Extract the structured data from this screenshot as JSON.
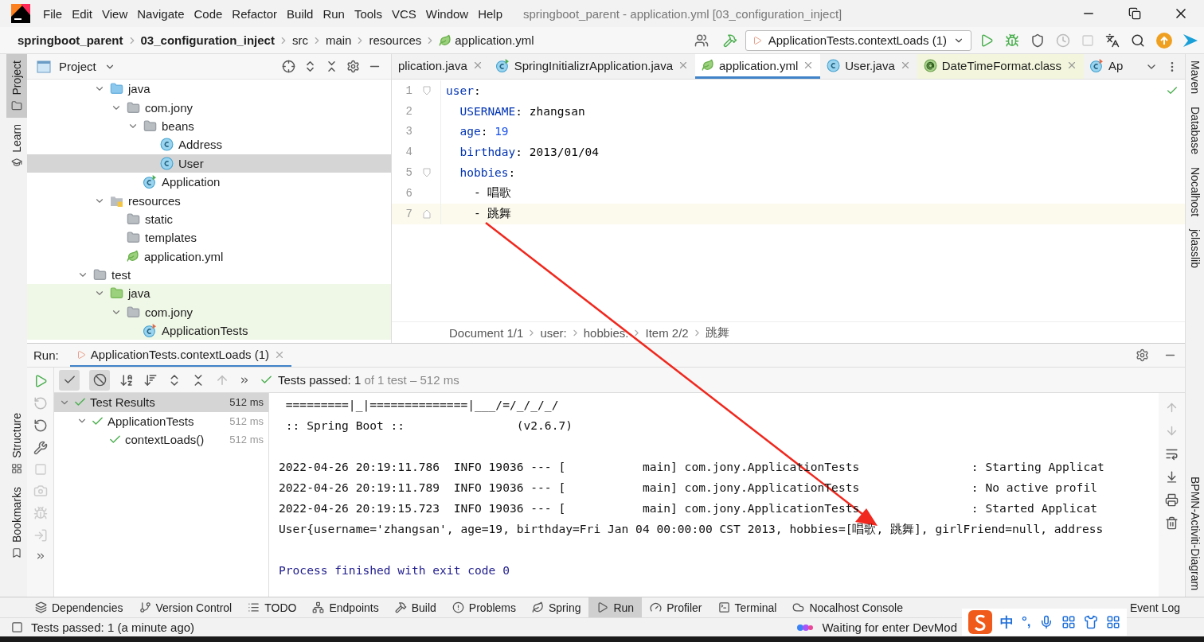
{
  "window": {
    "title": "springboot_parent - application.yml [03_configuration_inject]"
  },
  "menu": [
    "File",
    "Edit",
    "View",
    "Navigate",
    "Code",
    "Refactor",
    "Build",
    "Run",
    "Tools",
    "VCS",
    "Window",
    "Help"
  ],
  "breadcrumbs": [
    {
      "label": "springboot_parent",
      "bold": true,
      "kind": "folder"
    },
    {
      "label": "03_configuration_inject",
      "bold": true,
      "kind": "folder"
    },
    {
      "label": "src",
      "bold": false,
      "kind": "folder"
    },
    {
      "label": "main",
      "bold": false,
      "kind": "folder"
    },
    {
      "label": "resources",
      "bold": false,
      "kind": "folder"
    },
    {
      "label": "application.yml",
      "bold": false,
      "kind": "yaml"
    }
  ],
  "run_configuration": "ApplicationTests.contextLoads (1)",
  "left_tool_windows": [
    {
      "label": "Project",
      "selected": true
    },
    {
      "label": "Learn",
      "selected": false
    },
    {
      "label": "Structure",
      "selected": false
    },
    {
      "label": "Bookmarks",
      "selected": false
    }
  ],
  "right_tool_windows": [
    {
      "label": "Maven"
    },
    {
      "label": "Database"
    },
    {
      "label": "Nocalhost"
    },
    {
      "label": "jclasslib"
    }
  ],
  "project": {
    "title": "Project",
    "tree": [
      {
        "children": [
          {
            "label": "java",
            "kind": "source",
            "expanded": true,
            "selected": false,
            "children": [
              {
                "label": "com.jony",
                "kind": "package",
                "expanded": true,
                "selected": false,
                "children": [
                  {
                    "label": "beans",
                    "kind": "package",
                    "expanded": true,
                    "selected": false,
                    "children": [
                      {
                        "label": "Address",
                        "kind": "class",
                        "selected": false
                      },
                      {
                        "label": "User",
                        "kind": "class",
                        "selected": true
                      }
                    ]
                  },
                  {
                    "label": "Application",
                    "kind": "app",
                    "selected": false
                  }
                ]
              }
            ]
          },
          {
            "label": "resources",
            "kind": "resources",
            "expanded": true,
            "selected": false,
            "children": [
              {
                "label": "static",
                "kind": "folder",
                "selected": false
              },
              {
                "label": "templates",
                "kind": "folder",
                "selected": false
              },
              {
                "label": "application.yml",
                "kind": "yaml",
                "selected": false
              }
            ]
          }
        ]
      },
      {
        "label": "test",
        "kind": "folder",
        "expanded": true,
        "selected": false,
        "children": [
          {
            "label": "java",
            "kind": "testsource",
            "expanded": true,
            "selected": false,
            "children": [
              {
                "label": "com.jony",
                "kind": "package",
                "expanded": true,
                "selected": false,
                "children": [
                  {
                    "label": "ApplicationTests",
                    "kind": "test",
                    "selected": false
                  }
                ]
              }
            ]
          }
        ]
      }
    ]
  },
  "editor": {
    "tabs": [
      {
        "label": "plication.java",
        "kind": "plain",
        "selected": false
      },
      {
        "label": "SpringInitializrApplication.java",
        "kind": "app",
        "selected": false
      },
      {
        "label": "application.yml",
        "kind": "yaml",
        "selected": true
      },
      {
        "label": "User.java",
        "kind": "class",
        "selected": false
      },
      {
        "label": "DateTimeFormat.class",
        "kind": "annotation",
        "selected": false
      },
      {
        "label": "Ap",
        "kind": "test",
        "selected": false
      }
    ],
    "lines": [
      {
        "number": "1",
        "kind": "opener",
        "current": false,
        "tokens": [
          {
            "kind": "key",
            "text": "user"
          },
          {
            "kind": "plain",
            "text": ":"
          }
        ]
      },
      {
        "number": "2",
        "kind": "plain",
        "current": false,
        "tokens": [
          {
            "kind": "key",
            "text": "  USERNAME"
          },
          {
            "kind": "plain",
            "text": ": zhangsan"
          }
        ]
      },
      {
        "number": "3",
        "kind": "plain",
        "current": false,
        "tokens": [
          {
            "kind": "key",
            "text": "  age"
          },
          {
            "kind": "plain",
            "text": ": "
          },
          {
            "kind": "number",
            "text": "19"
          }
        ]
      },
      {
        "number": "4",
        "kind": "plain",
        "current": false,
        "tokens": [
          {
            "kind": "key",
            "text": "  birthday"
          },
          {
            "kind": "plain",
            "text": ": 2013/01/04"
          }
        ]
      },
      {
        "number": "5",
        "kind": "opener",
        "current": false,
        "tokens": [
          {
            "kind": "key",
            "text": "  hobbies"
          },
          {
            "kind": "plain",
            "text": ":"
          }
        ]
      },
      {
        "number": "6",
        "kind": "plain",
        "current": false,
        "tokens": [
          {
            "kind": "plain",
            "text": "    - 唱歌"
          }
        ]
      },
      {
        "number": "7",
        "kind": "closer",
        "current": true,
        "tokens": [
          {
            "kind": "plain",
            "text": "    - 跳舞"
          }
        ]
      }
    ],
    "breadcrumbs": [
      "Document 1/1",
      "user:",
      "hobbies:",
      "Item 2/2",
      "跳舞"
    ]
  },
  "run": {
    "label": "Run:",
    "tab": "ApplicationTests.contextLoads (1)",
    "status": "Tests passed: 1",
    "summary": "of 1 test – 512 ms",
    "tree": [
      {
        "label": "Test Results",
        "time": "512 ms",
        "selected": true,
        "expanded": true,
        "children": [
          {
            "label": "ApplicationTests",
            "time": "512 ms",
            "selected": false,
            "expanded": true,
            "children": [
              {
                "label": "contextLoads()",
                "time": "512 ms",
                "selected": false
              }
            ]
          }
        ]
      }
    ],
    "console": [
      {
        "lines": [
          {
            "kind": "plain",
            "text": " =========|_|==============|___/=/_/_/_/"
          },
          {
            "kind": "plain",
            "text": " :: Spring Boot ::                (v2.6.7)"
          }
        ]
      },
      {
        "lines": [
          {
            "kind": "plain",
            "text": "2022-04-26 20:19:11.786  INFO 19036 --- [           main] com.jony.ApplicationTests                : Starting Applicat"
          },
          {
            "kind": "plain",
            "text": "2022-04-26 20:19:11.789  INFO 19036 --- [           main] com.jony.ApplicationTests                : No active profil"
          },
          {
            "kind": "plain",
            "text": "2022-04-26 20:19:15.723  INFO 19036 --- [           main] com.jony.ApplicationTests                : Started Applicat"
          },
          {
            "kind": "plain",
            "text": "User{username='zhangsan', age=19, birthday=Fri Jan 04 00:00:00 CST 2013, hobbies=[唱歌, 跳舞], girlFriend=null, address"
          }
        ]
      },
      {
        "lines": [
          {
            "kind": "system",
            "text": "Process finished with exit code 0"
          }
        ]
      }
    ],
    "side_label": "BPMN-Activiti-Diagram"
  },
  "tool_tabs": [
    {
      "label": "Dependencies",
      "kind": "layers",
      "selected": false
    },
    {
      "label": "Version Control",
      "kind": "branch",
      "selected": false
    },
    {
      "label": "TODO",
      "kind": "list",
      "selected": false
    },
    {
      "label": "Endpoints",
      "kind": "network",
      "selected": false
    },
    {
      "label": "Build",
      "kind": "hammer",
      "selected": false
    },
    {
      "label": "Problems",
      "kind": "alert",
      "selected": false
    },
    {
      "label": "Spring",
      "kind": "leaf",
      "selected": false
    },
    {
      "label": "Run",
      "kind": "play",
      "selected": true
    },
    {
      "label": "Profiler",
      "kind": "gauge",
      "selected": false
    },
    {
      "label": "Terminal",
      "kind": "terminal",
      "selected": false
    },
    {
      "label": "Nocalhost Console",
      "kind": "cloud",
      "selected": false
    }
  ],
  "event_log": "Event Log",
  "status_bar": {
    "message": "Tests passed: 1 (a minute ago)",
    "right": "Waiting for enter DevMod"
  },
  "ime": {
    "mode": "中",
    "punct": "°,"
  }
}
